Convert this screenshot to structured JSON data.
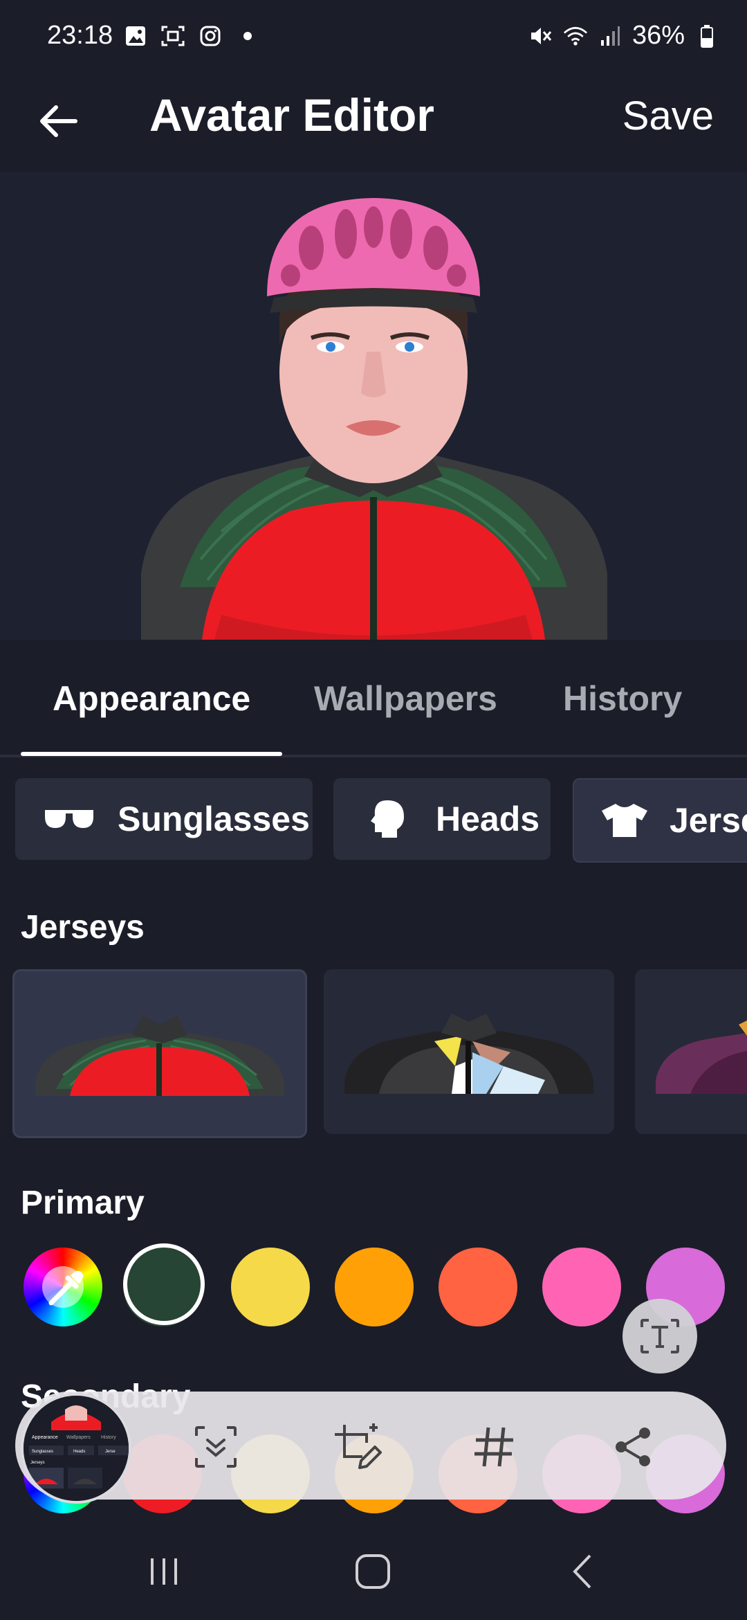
{
  "status_bar": {
    "time": "23:18",
    "battery": "36%",
    "left_icons": [
      "gallery-icon",
      "screenshot-icon",
      "instagram-icon",
      "dot-icon"
    ],
    "right_icons": [
      "mute-icon",
      "wifi-icon",
      "signal-icon",
      "battery-icon"
    ]
  },
  "app_bar": {
    "title": "Avatar Editor",
    "save_label": "Save"
  },
  "tabs": [
    {
      "label": "Appearance",
      "active": true
    },
    {
      "label": "Wallpapers",
      "active": false
    },
    {
      "label": "History",
      "active": false
    }
  ],
  "categories": [
    {
      "label": "Sunglasses",
      "icon": "sunglasses-icon"
    },
    {
      "label": "Heads",
      "icon": "head-icon"
    },
    {
      "label": "Jerse",
      "icon": "tshirt-icon"
    }
  ],
  "sections": {
    "jerseys_title": "Jerseys",
    "primary_title": "Primary",
    "secondary_title": "Secondary"
  },
  "colors": {
    "primary_swatches": [
      "picker",
      "#274534",
      "#f5d949",
      "#ffa106",
      "#ff6341",
      "#ff64b4",
      "#d86ad9"
    ],
    "secondary_swatches": [
      "picker",
      "#ee1c24",
      "#f5d949",
      "#ffa106",
      "#ff6341",
      "#ff64b4",
      "#d86ad9"
    ],
    "selected_primary": "#274534",
    "accent": "#ffffff",
    "background": "#1b1d29"
  },
  "toolbar": {
    "icons": [
      "scroll-capture-icon",
      "crop-edit-icon",
      "hashtag-icon",
      "share-icon"
    ],
    "thumbnail_text": {
      "tab1": "Appearance",
      "tab2": "Wallpapers",
      "tab3": "History",
      "chip1": "Sunglasses",
      "chip2": "Heads",
      "chip3": "Jerse",
      "section": "Jerseys"
    }
  }
}
